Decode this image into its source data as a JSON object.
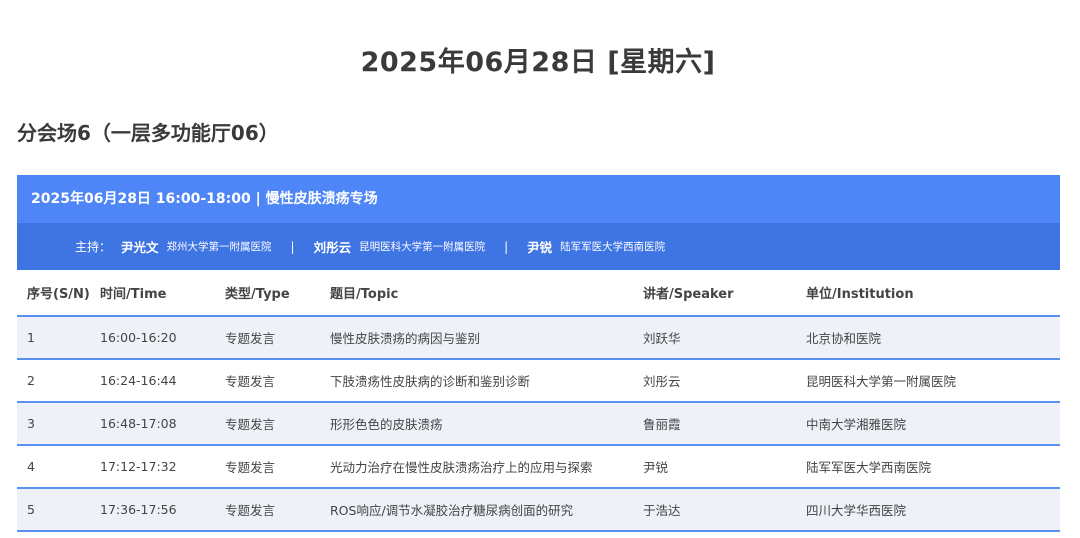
{
  "date_title": "2025年06月28日 [星期六]",
  "venue_title": "分会场6（一层多功能厅06）",
  "session": {
    "header": "2025年06月28日 16:00-18:00 | 慢性皮肤溃疡专场",
    "chair_label": "主持：",
    "chairs": [
      {
        "name": "尹光文",
        "institution": "郑州大学第一附属医院"
      },
      {
        "name": "刘彤云",
        "institution": "昆明医科大学第一附属医院"
      },
      {
        "name": "尹锐",
        "institution": "陆军军医大学西南医院"
      }
    ],
    "separator": "|"
  },
  "columns": [
    "序号(S/N)",
    "时间/Time",
    "类型/Type",
    "题目/Topic",
    "讲者/Speaker",
    "单位/Institution"
  ],
  "rows": [
    {
      "sn": "1",
      "time": "16:00-16:20",
      "type": "专题发言",
      "topic": "慢性皮肤溃疡的病因与鉴别",
      "speaker": "刘跃华",
      "institution": "北京协和医院"
    },
    {
      "sn": "2",
      "time": "16:24-16:44",
      "type": "专题发言",
      "topic": "下肢溃疡性皮肤病的诊断和鉴别诊断",
      "speaker": "刘彤云",
      "institution": "昆明医科大学第一附属医院"
    },
    {
      "sn": "3",
      "time": "16:48-17:08",
      "type": "专题发言",
      "topic": "形形色色的皮肤溃疡",
      "speaker": "鲁丽霞",
      "institution": "中南大学湘雅医院"
    },
    {
      "sn": "4",
      "time": "17:12-17:32",
      "type": "专题发言",
      "topic": "光动力治疗在慢性皮肤溃疡治疗上的应用与探索",
      "speaker": "尹锐",
      "institution": "陆军军医大学西南医院"
    },
    {
      "sn": "5",
      "time": "17:36-17:56",
      "type": "专题发言",
      "topic": "ROS响应/调节水凝胶治疗糖尿病创面的研究",
      "speaker": "于浩达",
      "institution": "四川大学华西医院"
    }
  ],
  "colors": {
    "header_bg": "#4f86f7",
    "chair_bg": "#3f74e3",
    "row_alt_bg": "#eef2f8",
    "row_border": "#5b8ff0"
  }
}
